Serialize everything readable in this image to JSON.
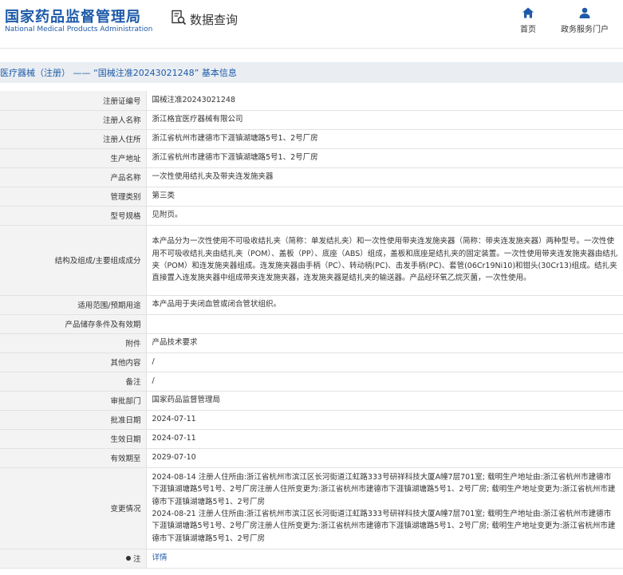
{
  "header": {
    "logo_cn": "国家药品监督管理局",
    "logo_en": "National Medical Products Administration",
    "query_label": "数据查询",
    "nav": [
      {
        "label": "首页",
        "icon": "home-icon"
      },
      {
        "label": "政务服务门户",
        "icon": "user-icon"
      }
    ]
  },
  "breadcrumb": "医疗器械（注册） —— “国械注准20243021248” 基本信息",
  "rows": [
    {
      "key": "注册证编号",
      "value": "国械注准20243021248"
    },
    {
      "key": "注册人名称",
      "value": "浙江格宜医疗器械有限公司"
    },
    {
      "key": "注册人住所",
      "value": "浙江省杭州市建德市下涯镇湖塘路5号1、2号厂房"
    },
    {
      "key": "生产地址",
      "value": "浙江省杭州市建德市下涯镇湖塘路5号1、2号厂房"
    },
    {
      "key": "产品名称",
      "value": "一次性使用结扎夹及带夹连发施夹器"
    },
    {
      "key": "管理类别",
      "value": "第三类"
    },
    {
      "key": "型号规格",
      "value": "见附页。"
    },
    {
      "key": "结构及组成/主要组成成分",
      "value": "本产品分为一次性使用不可吸收结扎夹（简称：单发结扎夹）和一次性使用带夹连发施夹器（简称：带夹连发施夹器）两种型号。一次性使用不可吸收结扎夹由结扎夹（POM）、盖板（PP）、底座（ABS）组成，盖板和底座是结扎夹的固定装置。一次性使用带夹连发施夹器由结扎夹（POM）和连发施夹器组成。连发施夹器由手柄（PC）、转动柄(PC)、击发手柄(PC)、套管(06Cr19Ni10)和钳头(30Cr13)组成。结扎夹直接置入连发施夹器中组成带夹连发施夹器，连发施夹器是结扎夹的输送器。产品经环氧乙烷灭菌，一次性使用。"
    },
    {
      "key": "适用范围/预期用途",
      "value": "本产品用于夹闭血管或闭合管状组织。"
    },
    {
      "key": "产品储存条件及有效期",
      "value": ""
    },
    {
      "key": "附件",
      "value": "产品技术要求"
    },
    {
      "key": "其他内容",
      "value": "/"
    },
    {
      "key": "备注",
      "value": "/"
    },
    {
      "key": "审批部门",
      "value": "国家药品监督管理局"
    },
    {
      "key": "批准日期",
      "value": "2024-07-11"
    },
    {
      "key": "生效日期",
      "value": "2024-07-11"
    },
    {
      "key": "有效期至",
      "value": "2029-07-10"
    }
  ],
  "change_row": {
    "key": "变更情况",
    "entries": [
      "2024-08-14 注册人住所由:浙江省杭州市滨江区长河街道江虹路333号研祥科技大厦A幢7层701室; 载明生产地址由:浙江省杭州市建德市下涯镇湖塘路5号1号、2号厂房注册人住所变更为:浙江省杭州市建德市下涯镇湖塘路5号1、2号厂房; 载明生产地址变更为:浙江省杭州市建德市下涯镇湖塘路5号1、2号厂房",
      "2024-08-21 注册人住所由:浙江省杭州市滨江区长河街道江虹路333号研祥科技大厦A幢7层701室; 载明生产地址由:浙江省杭州市建德市下涯镇湖塘路5号1号、2号厂房注册人住所变更为:浙江省杭州市建德市下涯镇湖塘路5号1、2号厂房; 载明生产地址变更为:浙江省杭州市建德市下涯镇湖塘路5号1、2号厂房"
    ]
  },
  "note_row": {
    "key": "注",
    "link": "详情"
  }
}
